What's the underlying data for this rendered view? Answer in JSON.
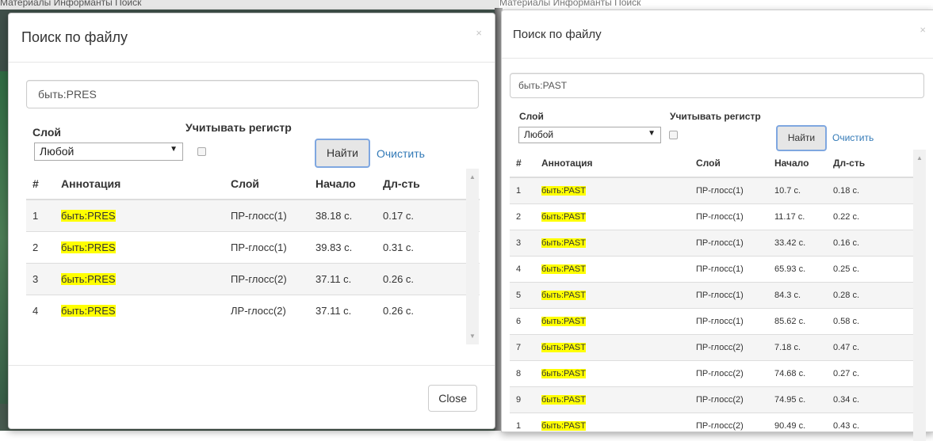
{
  "background": {
    "nav_left": "Материалы     Информанты     Поиск",
    "nav_right": "Материалы     Информанты     Поиск"
  },
  "left": {
    "title": "Поиск по файлу",
    "close_glyph": "×",
    "query": "быть:PRES",
    "layer_label": "Слой",
    "case_label": "Учитывать регистр",
    "layer_value": "Любой",
    "find_label": "Найти",
    "clear_label": "Очистить",
    "close_button": "Close",
    "columns": [
      "#",
      "Аннотация",
      "Слой",
      "Начало",
      "Дл-сть"
    ],
    "rows": [
      {
        "n": "1",
        "ann": "быть:PRES",
        "layer": "ПР-глосс(1)",
        "start": "38.18 с.",
        "dur": "0.17 с."
      },
      {
        "n": "2",
        "ann": "быть:PRES",
        "layer": "ПР-глосс(1)",
        "start": "39.83 с.",
        "dur": "0.31 с."
      },
      {
        "n": "3",
        "ann": "быть:PRES",
        "layer": "ПР-глосс(2)",
        "start": "37.11 с.",
        "dur": "0.26 с."
      },
      {
        "n": "4",
        "ann": "быть:PRES",
        "layer": "ЛР-глосс(2)",
        "start": "37.11 с.",
        "dur": "0.26 с."
      }
    ]
  },
  "right": {
    "title": "Поиск по файлу",
    "close_glyph": "×",
    "query": "быть:PAST",
    "layer_label": "Слой",
    "case_label": "Учитывать регистр",
    "layer_value": "Любой",
    "find_label": "Найти",
    "clear_label": "Очистить",
    "columns": [
      "#",
      "Аннотация",
      "Слой",
      "Начало",
      "Дл-сть"
    ],
    "rows": [
      {
        "n": "1",
        "ann": "быть:PAST",
        "layer": "ПР-глосс(1)",
        "start": "10.7 с.",
        "dur": "0.18 с."
      },
      {
        "n": "2",
        "ann": "быть:PAST",
        "layer": "ПР-глосс(1)",
        "start": "11.17 с.",
        "dur": "0.22 с."
      },
      {
        "n": "3",
        "ann": "быть:PAST",
        "layer": "ПР-глосс(1)",
        "start": "33.42 с.",
        "dur": "0.16 с."
      },
      {
        "n": "4",
        "ann": "быть:PAST",
        "layer": "ПР-глосс(1)",
        "start": "65.93 с.",
        "dur": "0.25 с."
      },
      {
        "n": "5",
        "ann": "быть:PAST",
        "layer": "ПР-глосс(1)",
        "start": "84.3 с.",
        "dur": "0.28 с."
      },
      {
        "n": "6",
        "ann": "быть:PAST",
        "layer": "ПР-глосс(1)",
        "start": "85.62 с.",
        "dur": "0.58 с."
      },
      {
        "n": "7",
        "ann": "быть:PAST",
        "layer": "ПР-глосс(2)",
        "start": "7.18 с.",
        "dur": "0.47 с."
      },
      {
        "n": "8",
        "ann": "быть:PAST",
        "layer": "ПР-глосс(2)",
        "start": "74.68 с.",
        "dur": "0.27 с."
      },
      {
        "n": "9",
        "ann": "быть:PAST",
        "layer": "ПР-глосс(2)",
        "start": "74.95 с.",
        "dur": "0.34 с."
      },
      {
        "n": "1",
        "ann": "быть:PAST",
        "layer": "ПР-глосс(2)",
        "start": "90.49 с.",
        "dur": "0.43 с."
      }
    ]
  }
}
